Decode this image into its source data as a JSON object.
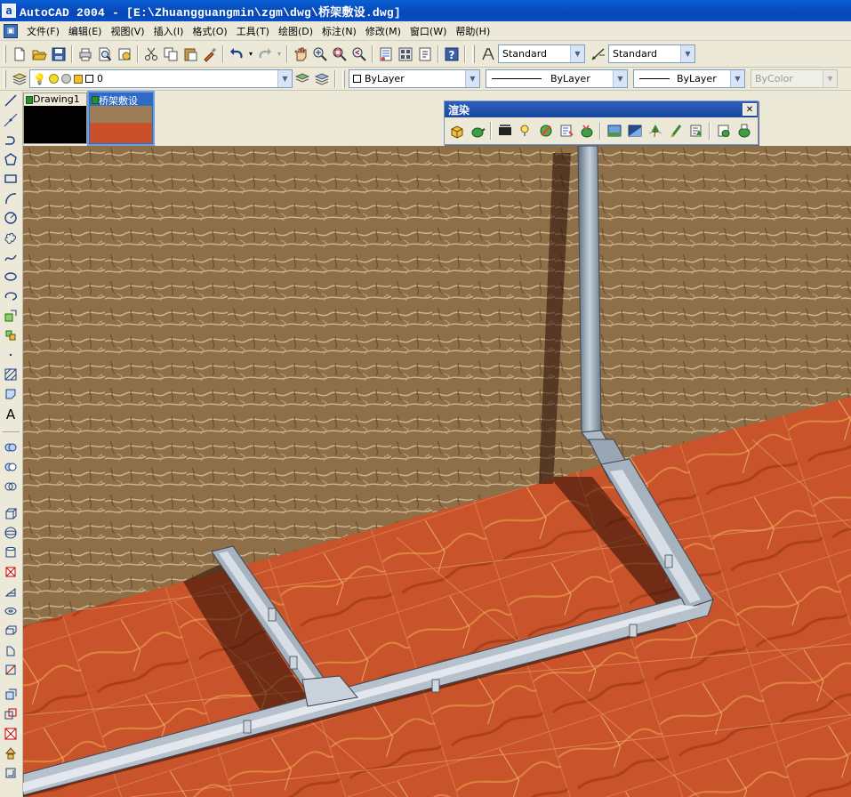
{
  "window": {
    "title": "AutoCAD 2004 - [E:\\Zhuangguangmin\\zgm\\dwg\\桥架敷设.dwg]",
    "app_icon": "a"
  },
  "menu": [
    "文件(F)",
    "编辑(E)",
    "视图(V)",
    "插入(I)",
    "格式(O)",
    "工具(T)",
    "绘图(D)",
    "标注(N)",
    "修改(M)",
    "窗口(W)",
    "帮助(H)"
  ],
  "styles": {
    "text_style": "Standard",
    "dim_style": "Standard"
  },
  "layers": {
    "current_layer": "0"
  },
  "properties": {
    "color": "ByLayer",
    "linetype": "ByLayer",
    "lineweight": "ByLayer",
    "plot_style": "ByColor"
  },
  "drawing_tabs": [
    {
      "label": "Drawing1",
      "active": false
    },
    {
      "label": "桥架敷设",
      "active": true
    }
  ],
  "render_toolbar": {
    "title": "渲染",
    "close": "✕"
  },
  "icons": {
    "standard_toolbar": [
      "new-icon",
      "open-icon",
      "save-icon",
      "print-icon",
      "print-preview-icon",
      "publish-icon",
      "cut-icon",
      "copy-icon",
      "paste-icon",
      "match-properties-icon",
      "undo-icon",
      "redo-icon",
      "pan-icon",
      "zoom-realtime-icon",
      "zoom-window-icon",
      "zoom-previous-icon",
      "properties-icon",
      "designcenter-icon",
      "tool-palettes-icon",
      "help-icon"
    ],
    "draw_toolbar": [
      "line-icon",
      "construction-line-icon",
      "polyline-icon",
      "polygon-icon",
      "rectangle-icon",
      "arc-icon",
      "circle-icon",
      "revision-cloud-icon",
      "spline-icon",
      "ellipse-icon",
      "ellipse-arc-icon",
      "insert-block-icon",
      "make-block-icon",
      "point-icon",
      "hatch-icon",
      "region-icon",
      "multiline-text-icon"
    ],
    "solids_toolbar": [
      "union-icon",
      "subtract-icon",
      "intersect-icon",
      "box-icon",
      "sphere-icon",
      "cylinder-icon",
      "cone-icon",
      "wedge-icon",
      "torus-icon",
      "extrude-icon",
      "revolve-icon",
      "slice-icon",
      "section-icon",
      "interfere-icon",
      "setup-drawing-icon",
      "setup-view-icon",
      "setup-profile-icon"
    ],
    "render_tools": [
      "hide-icon",
      "render-icon",
      "scenes-icon",
      "lights-icon",
      "materials-icon",
      "materials-library-icon",
      "mapping-icon",
      "background-icon",
      "fog-icon",
      "new-landscape-icon",
      "edit-landscape-icon",
      "landscape-library-icon",
      "render-preferences-icon",
      "statistics-icon"
    ]
  },
  "colors": {
    "title_bar": "#0a4fc6",
    "toolbar": "#ece9d8",
    "wall": "#8a6a45",
    "floor": "#c8502a",
    "tray": "#9aa7b6"
  }
}
